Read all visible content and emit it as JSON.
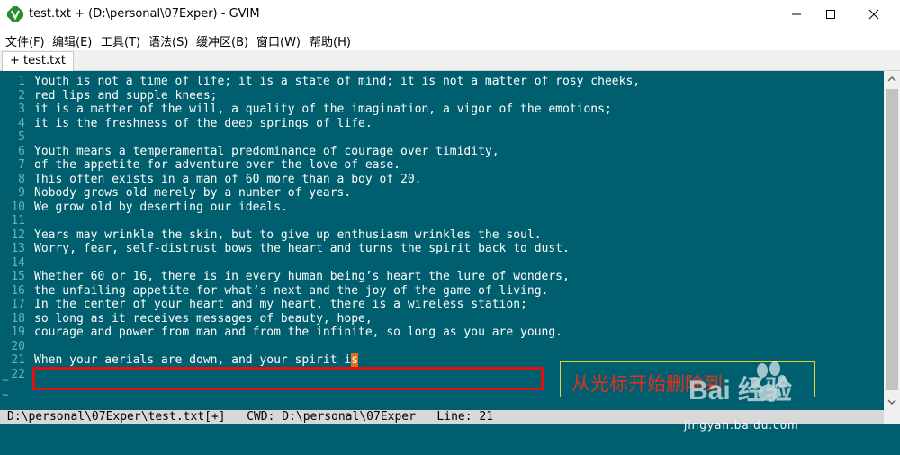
{
  "window": {
    "title": "test.txt + (D:\\personal\\07Exper) - GVIM"
  },
  "menu": [
    "文件(F)",
    "编辑(E)",
    "工具(T)",
    "语法(S)",
    "缓冲区(B)",
    "窗口(W)",
    "帮助(H)"
  ],
  "tab": {
    "label": "+ test.txt"
  },
  "editor": {
    "lines": [
      {
        "num": "1",
        "text": "Youth is not a time of life; it is a state of mind; it is not a matter of rosy cheeks,"
      },
      {
        "num": "2",
        "text": "red lips and supple knees;"
      },
      {
        "num": "3",
        "text": "it is a matter of the will, a quality of the imagination, a vigor of the emotions;"
      },
      {
        "num": "4",
        "text": "it is the freshness of the deep springs of life."
      },
      {
        "num": "5",
        "text": ""
      },
      {
        "num": "6",
        "text": "Youth means a temperamental predominance of courage over timidity,"
      },
      {
        "num": "7",
        "text": "of the appetite for adventure over the love of ease."
      },
      {
        "num": "8",
        "text": "This often exists in a man of 60 more than a boy of 20."
      },
      {
        "num": "9",
        "text": "Nobody grows old merely by a number of years."
      },
      {
        "num": "10",
        "text": "We grow old by deserting our ideals."
      },
      {
        "num": "11",
        "text": ""
      },
      {
        "num": "12",
        "text": "Years may wrinkle the skin, but to give up enthusiasm wrinkles the soul."
      },
      {
        "num": "13",
        "text": "Worry, fear, self-distrust bows the heart and turns the spirit back to dust."
      },
      {
        "num": "14",
        "text": ""
      },
      {
        "num": "15",
        "text": "Whether 60 or 16, there is in every human being’s heart the lure of wonders,"
      },
      {
        "num": "16",
        "text": "the unfailing appetite for what’s next and the joy of the game of living."
      },
      {
        "num": "17",
        "text": "In the center of your heart and my heart, there is a wireless station;"
      },
      {
        "num": "18",
        "text": "so long as it receives messages of beauty, hope,"
      },
      {
        "num": "19",
        "text": "courage and power from man and from the infinite, so long as you are young."
      },
      {
        "num": "20",
        "text": ""
      },
      {
        "num": "21",
        "text": "When your aerials are down, and your spirit i"
      },
      {
        "num": "22",
        "text": ""
      }
    ],
    "cursor_char": "s",
    "tildes": [
      "~",
      "~"
    ]
  },
  "status": {
    "text": "D:\\personal\\07Exper\\test.txt[+]   CWD: D:\\personal\\07Exper   Line: 21"
  },
  "annotation": {
    "text": "从光标开始删除到"
  },
  "watermark": {
    "brand": "Bai 经验",
    "url": "jingyan.baidu.com"
  },
  "colors": {
    "editor_bg": "#005f6f",
    "cursor": "#e0701e",
    "highlight_box": "#e01010",
    "annotation_text": "#e03020"
  }
}
